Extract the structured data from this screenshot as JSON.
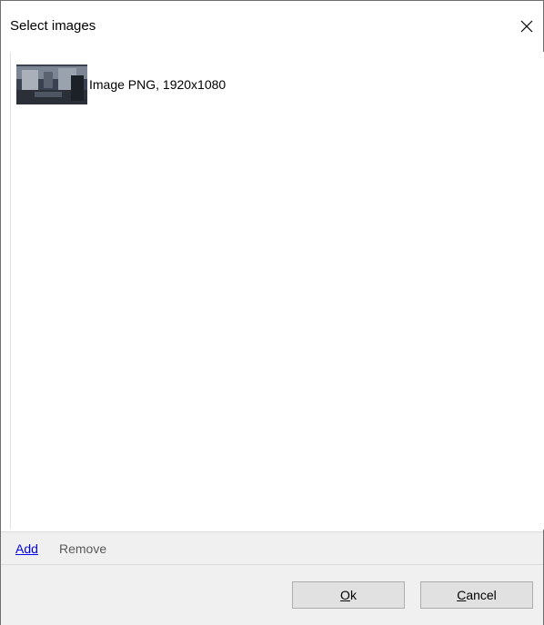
{
  "dialog": {
    "title": "Select images",
    "close_icon": "close-icon"
  },
  "images": [
    {
      "label": "Image PNG, 1920x1080",
      "thumbnail_icon": "image-thumbnail"
    }
  ],
  "links": {
    "add": "Add",
    "remove": "Remove"
  },
  "buttons": {
    "ok_mnemonic": "O",
    "ok_rest": "k",
    "cancel_mnemonic": "C",
    "cancel_rest": "ancel"
  },
  "colors": {
    "link": "#0000ee",
    "panel": "#f0f0f0",
    "button": "#e1e1e1"
  }
}
